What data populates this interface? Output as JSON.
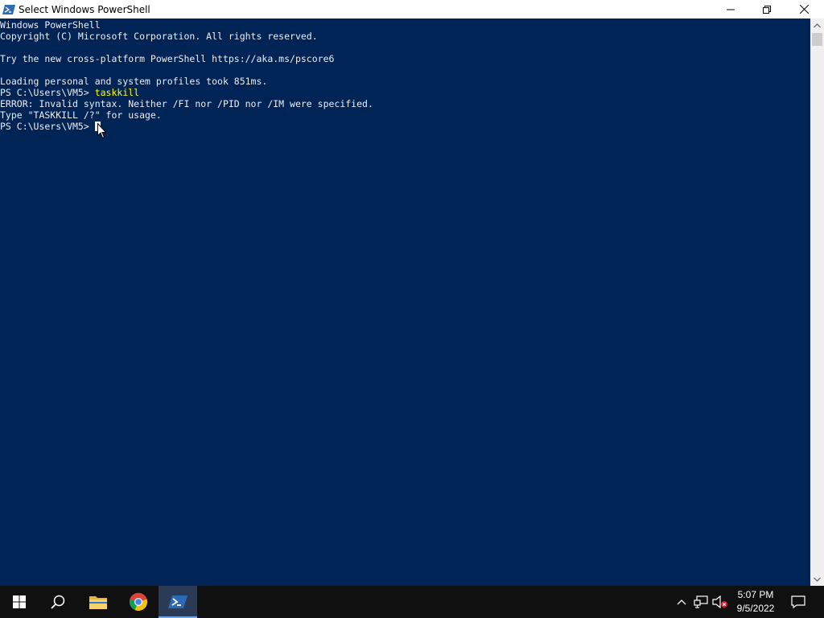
{
  "window": {
    "title": "Select Windows PowerShell",
    "controls": {
      "minimize": "minimize",
      "maximize": "restore",
      "close": "close"
    }
  },
  "console": {
    "lines": [
      {
        "text": "Windows PowerShell"
      },
      {
        "text": "Copyright (C) Microsoft Corporation. All rights reserved."
      },
      {
        "text": ""
      },
      {
        "text": "Try the new cross-platform PowerShell https://aka.ms/pscore6"
      },
      {
        "text": ""
      },
      {
        "text": "Loading personal and system profiles took 851ms."
      },
      {
        "prompt": "PS C:\\Users\\VM5> ",
        "command": "taskkill"
      },
      {
        "text": "ERROR: Invalid syntax. Neither /FI nor /PID nor /IM were specified."
      },
      {
        "text": "Type \"TASKKILL /?\" for usage."
      },
      {
        "prompt": "PS C:\\Users\\VM5> ",
        "command": ""
      }
    ]
  },
  "taskbar": {
    "items": [
      "start-icon",
      "search-icon",
      "file-explorer-icon",
      "chrome-icon",
      "powershell-icon"
    ],
    "active_item": "powershell-icon",
    "tray": [
      "chevron-up-icon",
      "network-icon",
      "volume-muted-icon"
    ],
    "clock": {
      "time": "5:07 PM",
      "date": "9/5/2022"
    },
    "notification_icon": "notification-icon"
  },
  "colors": {
    "console_bg": "#012456",
    "console_fg": "#eeedf0",
    "command_fg": "#ffff00",
    "taskbar_bg": "#101010"
  }
}
